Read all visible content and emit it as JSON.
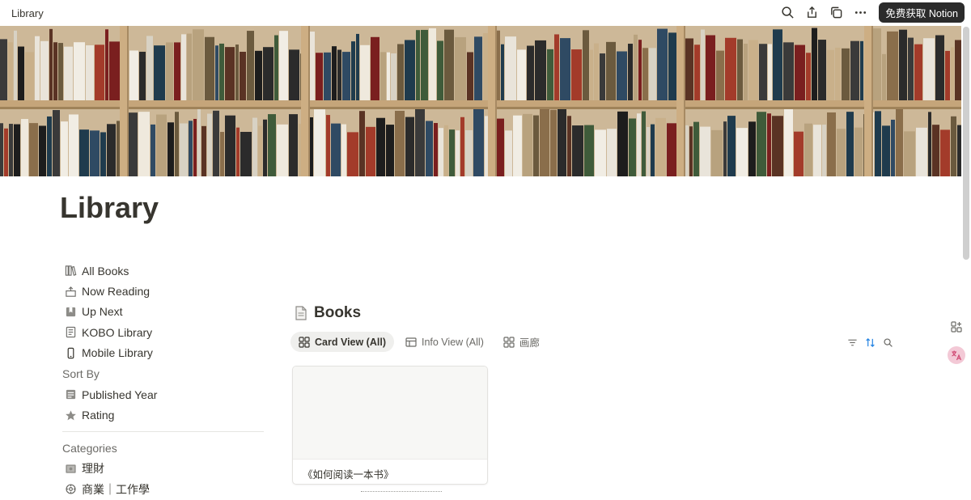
{
  "window": {
    "title": "Library"
  },
  "topbar": {
    "breadcrumb": "Library",
    "icons": [
      "search-icon",
      "share-icon",
      "duplicate-icon",
      "more-icon"
    ],
    "cta_label": "免费获取 Notion"
  },
  "page": {
    "title": "Library"
  },
  "nav": {
    "items": [
      {
        "label": "All Books",
        "icon": "books-icon"
      },
      {
        "label": "Now Reading",
        "icon": "open-box-icon"
      },
      {
        "label": "Up Next",
        "icon": "bookmark-icon"
      },
      {
        "label": "KOBO Library",
        "icon": "document-icon"
      },
      {
        "label": "Mobile Library",
        "icon": "phone-icon"
      }
    ],
    "sort_heading": "Sort By",
    "sort_items": [
      {
        "label": "Published Year",
        "icon": "calendar-icon"
      },
      {
        "label": "Rating",
        "icon": "star-icon"
      }
    ],
    "categories_heading": "Categories",
    "category_items": [
      {
        "label": "理財",
        "icon": "money-icon"
      },
      {
        "label": "商業｜工作學",
        "icon": "gear-icon"
      }
    ]
  },
  "database": {
    "title": "Books",
    "tabs": [
      {
        "label": "Card View (All)",
        "active": true,
        "icon": "gallery-icon"
      },
      {
        "label": "Info View (All)",
        "active": false,
        "icon": "table-icon"
      },
      {
        "label": "画廊",
        "active": false,
        "icon": "gallery-icon"
      }
    ],
    "tools": [
      "filter-icon",
      "sort-icon",
      "search-icon"
    ],
    "cards": [
      {
        "title": "《如何阅读一本书》"
      }
    ]
  },
  "colors": {
    "accent_blue": "#2383e2",
    "cta_bg": "#2b2b2b",
    "text": "#37352f"
  }
}
